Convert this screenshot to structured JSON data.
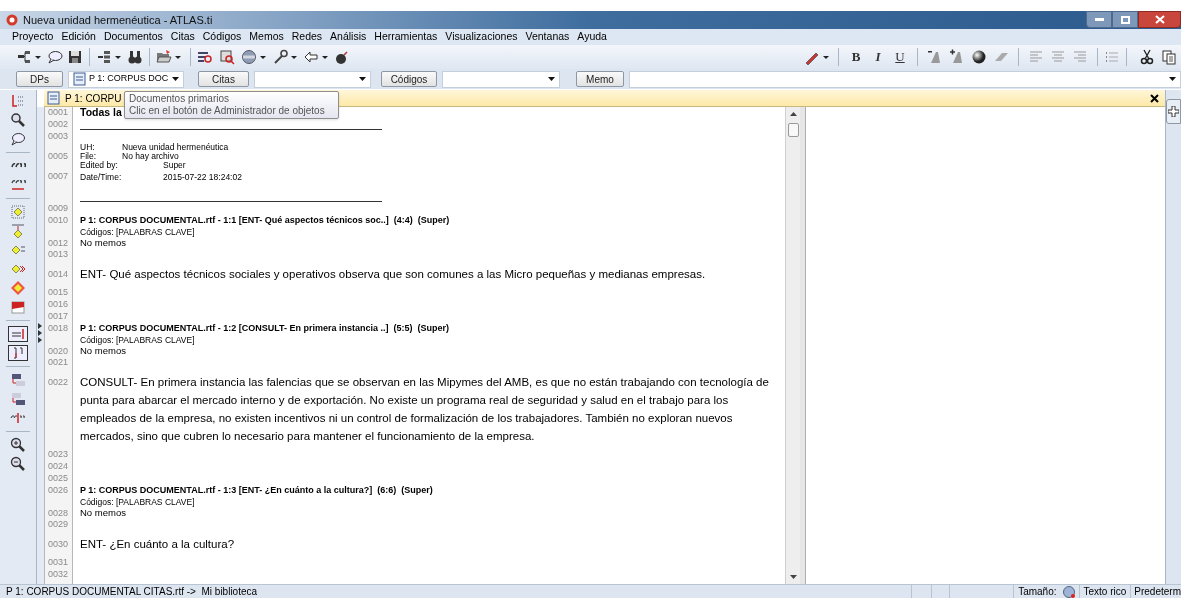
{
  "window": {
    "title": "Nueva unidad hermenéutica - ATLAS.ti"
  },
  "menu": [
    "Proyecto",
    "Edición",
    "Documentos",
    "Citas",
    "Códigos",
    "Memos",
    "Redes",
    "Análisis",
    "Herramientas",
    "Visualizaciones",
    "Ventanas",
    "Ayuda"
  ],
  "format_buttons": [
    "B",
    "I",
    "U"
  ],
  "selectors": [
    {
      "button": "DPs",
      "value": "P 1: CORPUS DOC"
    },
    {
      "button": "Citas"
    },
    {
      "button": "Códigos"
    },
    {
      "button": "Memo"
    }
  ],
  "document": {
    "tab_title": "P 1: CORPU",
    "lines": [
      {
        "number": "0001",
        "kind": "title",
        "text": "Todas la"
      },
      {
        "number": "0002",
        "kind": "rule"
      },
      {
        "number": "0003",
        "kind": "blank"
      },
      {
        "kind": "meta",
        "label": "UH:",
        "value": "Nueva unidad hermenéutica"
      },
      {
        "number": "0005",
        "kind": "meta",
        "label": "File:",
        "value": "No hay archivo"
      },
      {
        "kind": "meta-wide",
        "label": "Edited by:",
        "value": "Super"
      },
      {
        "number": "0007",
        "kind": "meta-wide",
        "label": "Date/Time:",
        "value": "2015-07-22 18:24:02"
      },
      {
        "kind": "rule"
      },
      {
        "number": "0009",
        "kind": "blank"
      },
      {
        "number": "0010",
        "kind": "heading",
        "marker": false,
        "text": "P 1: CORPUS DOCUMENTAL.rtf - 1:1 [ENT- Qué aspectos técnicos soc..]  (4:4)  (Super)"
      },
      {
        "kind": "codes",
        "text": "Códigos: [PALABRAS CLAVE]"
      },
      {
        "number": "0012",
        "kind": "plain",
        "text": "No memos"
      },
      {
        "number": "0013",
        "kind": "blank"
      },
      {
        "number": "0014",
        "kind": "para",
        "text": "ENT- Qué aspectos técnicos sociales y operativos observa que son comunes a las Micro pequeñas y medianas empresas."
      },
      {
        "number": "0015",
        "kind": "blank"
      },
      {
        "number": "0016",
        "kind": "blank"
      },
      {
        "number": "0017",
        "kind": "blank"
      },
      {
        "number": "0018",
        "kind": "heading",
        "marker": true,
        "text": "P 1: CORPUS DOCUMENTAL.rtf - 1:2 [CONSULT- En primera instancia ..]  (5:5)  (Super)"
      },
      {
        "kind": "codes",
        "text": "Códigos: [PALABRAS CLAVE]"
      },
      {
        "number": "0020",
        "kind": "plain",
        "text": "No memos"
      },
      {
        "number": "0021",
        "kind": "blank"
      },
      {
        "number": "0022",
        "kind": "para",
        "text": "CONSULT- En primera instancia las falencias que se observan en las Mipymes del AMB, es que no están trabajando con tecnología de\npunta para abarcar el mercado interno y de exportación. No existe un programa real de seguridad y salud en el trabajo para los\nempleados de la empresa, no existen incentivos ni un control de formalización de los trabajadores. También no exploran nuevos\nmercados, sino que cubren lo necesario para mantener el funcionamiento de la empresa."
      },
      {
        "number": "0023",
        "kind": "blank"
      },
      {
        "number": "0024",
        "kind": "blank"
      },
      {
        "number": "0025",
        "kind": "blank"
      },
      {
        "number": "0026",
        "kind": "heading",
        "marker": false,
        "text": "P 1: CORPUS DOCUMENTAL.rtf - 1:3 [ENT- ¿En cuánto a la cultura?]  (6:6)  (Super)"
      },
      {
        "kind": "codes",
        "text": "Códigos: [PALABRAS CLAVE]"
      },
      {
        "number": "0028",
        "kind": "plain",
        "text": "No memos"
      },
      {
        "number": "0029",
        "kind": "blank"
      },
      {
        "number": "0030",
        "kind": "para",
        "text": "ENT- ¿En cuánto a la cultura?"
      },
      {
        "number": "0031",
        "kind": "blank"
      },
      {
        "number": "0032",
        "kind": "blank"
      }
    ]
  },
  "tooltip": {
    "title": "Documentos primarios",
    "text": "Clic en el botón de Administrador de objetos"
  },
  "status_bar": {
    "path": "P 1: CORPUS DOCUMENTAL CITAS.rtf ->  Mi biblioteca",
    "size_label": "Tamaño:",
    "format": "Texto rico",
    "mode": "Predeterm"
  }
}
